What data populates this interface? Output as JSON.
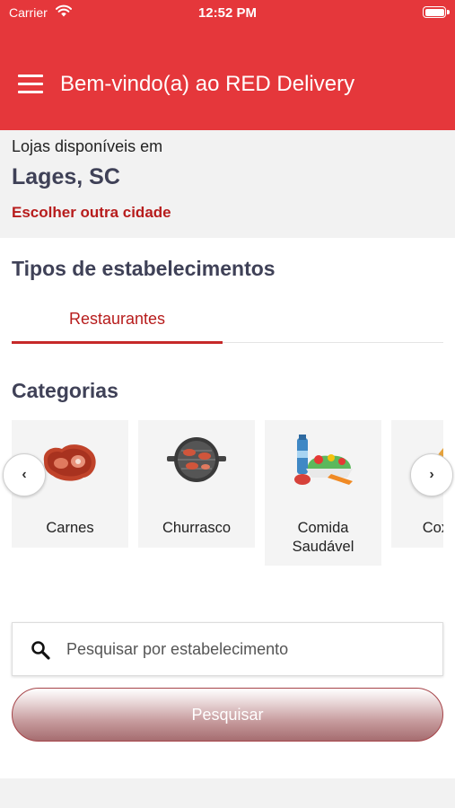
{
  "status_bar": {
    "carrier": "Carrier",
    "time": "12:52 PM"
  },
  "header": {
    "title": "Bem-vindo(a) ao RED Delivery",
    "background_color": "#e5373b"
  },
  "location": {
    "label": "Lojas disponíveis em",
    "city": "Lages, SC",
    "change_link": "Escolher outra cidade"
  },
  "establishment_types": {
    "title": "Tipos de estabelecimentos",
    "tabs": [
      {
        "label": "Restaurantes",
        "selected": true
      }
    ]
  },
  "categories": {
    "title": "Categorias",
    "prev_label": "‹",
    "next_label": "›",
    "items": [
      {
        "label": "Carnes",
        "icon": "meat-icon"
      },
      {
        "label": "Churrasco",
        "icon": "barbecue-grill-icon"
      },
      {
        "label": "Comida Saudável",
        "icon": "healthy-food-icon"
      },
      {
        "label": "Coxinha",
        "icon": "coxinha-icon"
      }
    ]
  },
  "search": {
    "placeholder": "Pesquisar por estabelecimento",
    "value": "",
    "button_label": "Pesquisar"
  },
  "colors": {
    "accent": "#e5373b",
    "link": "#b71c1c",
    "heading": "#3f4157"
  }
}
